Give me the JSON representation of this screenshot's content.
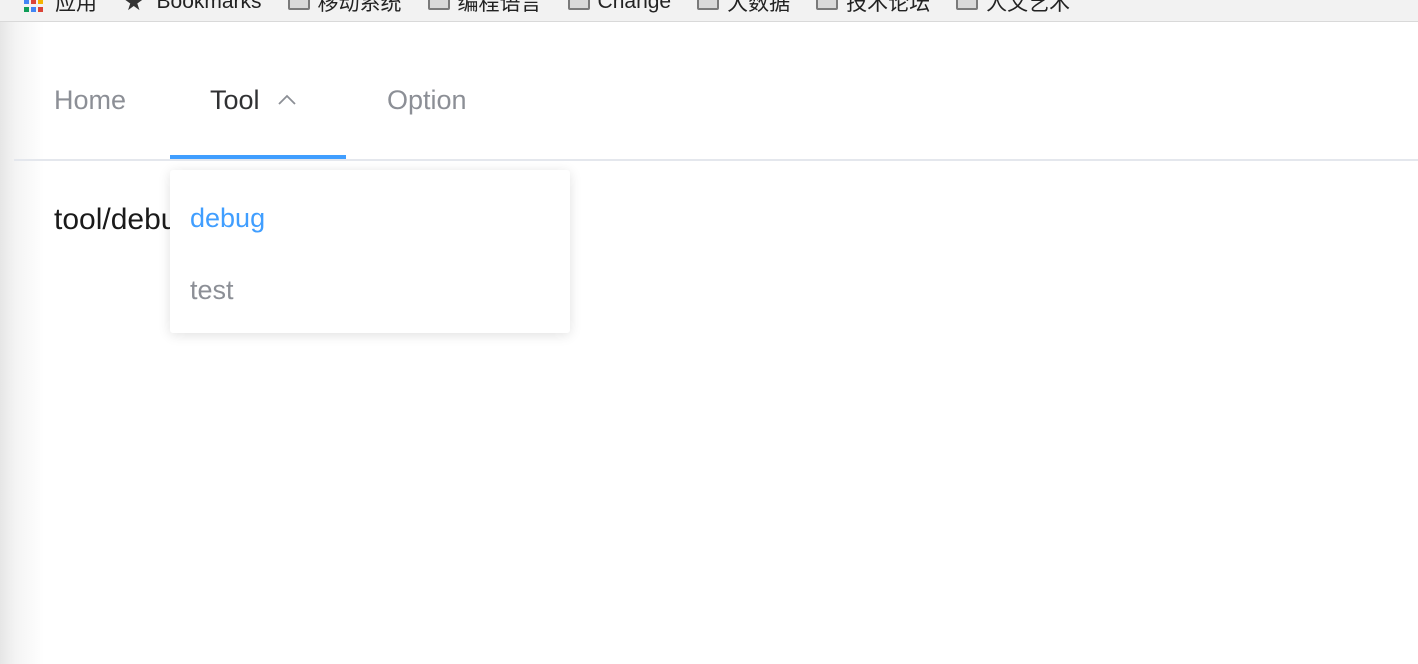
{
  "bookmarks_bar": {
    "items": [
      {
        "label": "应用",
        "icon": "apps-icon"
      },
      {
        "label": "Bookmarks",
        "icon": "star-icon"
      },
      {
        "label": "移动系统",
        "icon": "folder-icon"
      },
      {
        "label": "编程语言",
        "icon": "folder-icon"
      },
      {
        "label": "Change",
        "icon": "folder-icon"
      },
      {
        "label": "大数据",
        "icon": "folder-icon"
      },
      {
        "label": "技术论坛",
        "icon": "folder-icon"
      },
      {
        "label": "人文艺术",
        "icon": "folder-icon"
      }
    ]
  },
  "nav": {
    "items": [
      {
        "label": "Home"
      },
      {
        "label": "Tool",
        "icon": "chevron-up-icon",
        "active": true
      },
      {
        "label": "Option"
      }
    ],
    "colors": {
      "active_underline": "#409eff",
      "active_text": "#303133",
      "inactive_text": "#8c8f96"
    }
  },
  "content": {
    "text": "tool/debug"
  },
  "dropdown": {
    "items": [
      {
        "label": "debug",
        "active": true
      },
      {
        "label": "test"
      }
    ],
    "colors": {
      "active": "#409eff"
    }
  }
}
